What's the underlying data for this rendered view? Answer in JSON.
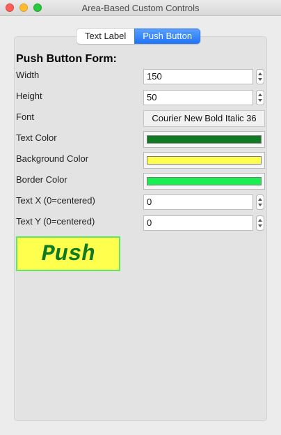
{
  "window": {
    "title": "Area-Based Custom Controls"
  },
  "tabs": [
    {
      "label": "Text Label",
      "active": false
    },
    {
      "label": "Push Button",
      "active": true
    }
  ],
  "form": {
    "title": "Push Button Form:",
    "width": {
      "label": "Width",
      "value": "150"
    },
    "height": {
      "label": "Height",
      "value": "50"
    },
    "font": {
      "label": "Font",
      "value": "Courier New Bold Italic 36"
    },
    "text_color": {
      "label": "Text Color",
      "color": "#0f7a22"
    },
    "background_color": {
      "label": "Background Color",
      "color": "#ffff4d"
    },
    "border_color": {
      "label": "Border Color",
      "color": "#19f04f"
    },
    "text_x": {
      "label": "Text X (0=centered)",
      "value": "0"
    },
    "text_y": {
      "label": "Text Y (0=centered)",
      "value": "0"
    }
  },
  "preview": {
    "label": "Push",
    "text_color": "#0f7a22",
    "background_color": "#ffff4d",
    "border_color": "#5ee86a"
  }
}
